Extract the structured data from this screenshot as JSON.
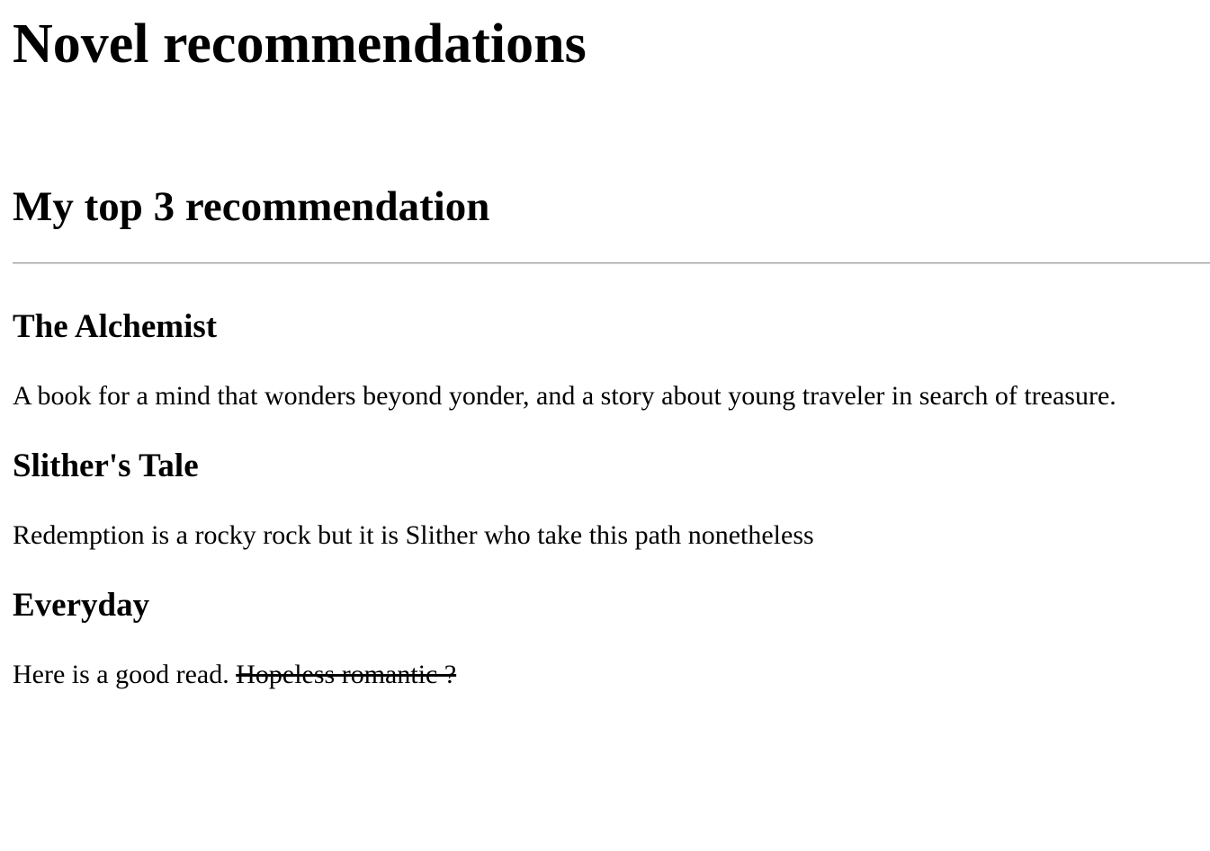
{
  "page": {
    "title": "Novel recommendations",
    "subtitle": "My top 3 recommendation"
  },
  "books": [
    {
      "title": "The Alchemist",
      "description": "A book for a mind that wonders beyond yonder, and a story about young traveler in search of treasure."
    },
    {
      "title": "Slither's Tale",
      "description": "Redemption is a rocky rock but it is Slither who take this path nonetheless"
    },
    {
      "title": "Everyday",
      "description": "Here is a good read.",
      "struck_text": "Hopeless romantic ?"
    }
  ]
}
